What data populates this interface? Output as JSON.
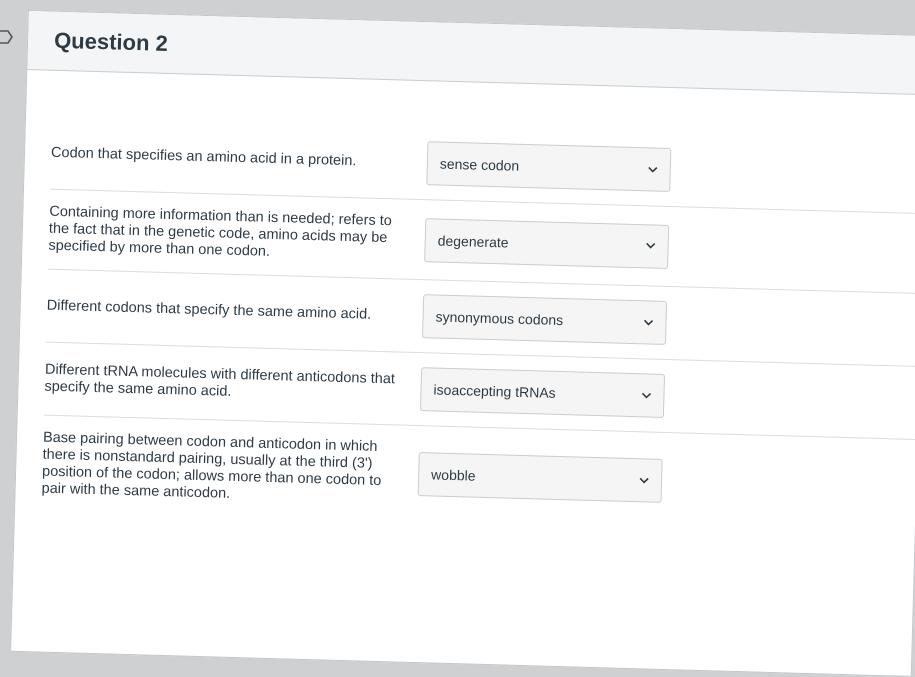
{
  "question": {
    "title": "Question 2",
    "rows": [
      {
        "prompt": "Codon that specifies an amino acid in a protein.",
        "answer": "sense codon"
      },
      {
        "prompt": "Containing more information than is needed; refers to the fact that in the genetic code, amino acids may be specified by more than one codon.",
        "answer": "degenerate"
      },
      {
        "prompt": "Different codons that specify the same amino acid.",
        "answer": "synonymous codons"
      },
      {
        "prompt": "Different tRNA molecules with different anticodons that specify the same amino acid.",
        "answer": "isoaccepting tRNAs"
      },
      {
        "prompt": "Base pairing between codon and anticodon in which there is nonstandard pairing, usually at the third (3') position of the codon; allows more than one codon to pair with the same anticodon.",
        "answer": "wobble"
      }
    ]
  }
}
